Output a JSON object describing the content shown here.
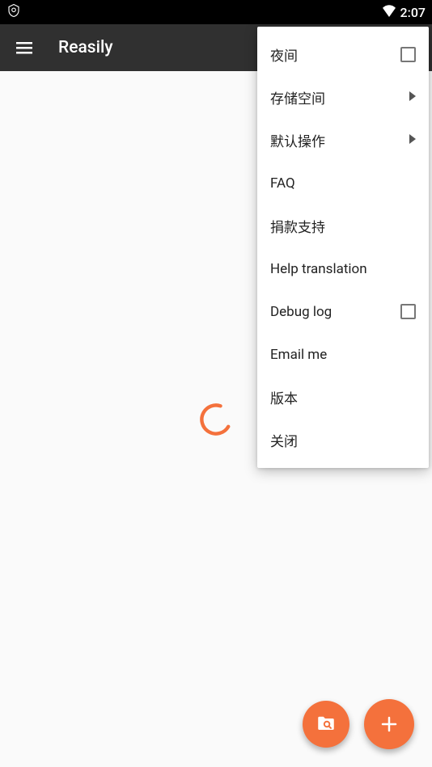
{
  "status": {
    "time": "2:07"
  },
  "appbar": {
    "title": "Reasily"
  },
  "menu": {
    "items": [
      {
        "label": "夜间",
        "type": "checkbox",
        "checked": false
      },
      {
        "label": "存储空间",
        "type": "submenu"
      },
      {
        "label": "默认操作",
        "type": "submenu"
      },
      {
        "label": "FAQ",
        "type": "action"
      },
      {
        "label": "捐款支持",
        "type": "action"
      },
      {
        "label": "Help translation",
        "type": "action"
      },
      {
        "label": "Debug log",
        "type": "checkbox",
        "checked": false
      },
      {
        "label": "Email me",
        "type": "action"
      },
      {
        "label": "版本",
        "type": "action"
      },
      {
        "label": "关闭",
        "type": "action"
      }
    ]
  },
  "colors": {
    "accent": "#f4713c",
    "appbar": "#303030"
  }
}
